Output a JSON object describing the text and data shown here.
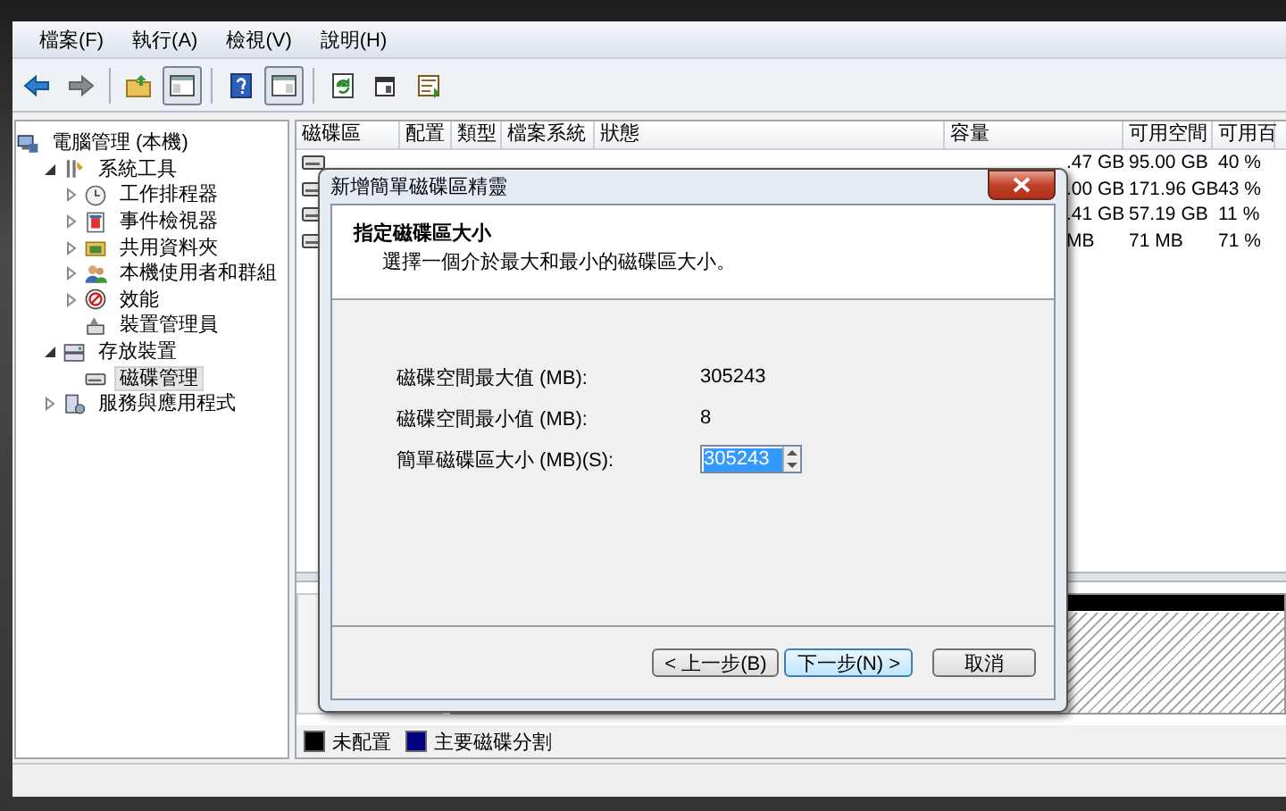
{
  "menu": [
    {
      "label": "檔案(F)"
    },
    {
      "label": "執行(A)"
    },
    {
      "label": "檢視(V)"
    },
    {
      "label": "說明(H)"
    }
  ],
  "toolbar": [
    {
      "kind": "back",
      "pressed": false
    },
    {
      "kind": "forward",
      "pressed": false
    },
    {
      "kind": "sep"
    },
    {
      "kind": "folder-up",
      "pressed": false
    },
    {
      "kind": "pane",
      "pressed": true
    },
    {
      "kind": "sep"
    },
    {
      "kind": "help",
      "pressed": false
    },
    {
      "kind": "pane2",
      "pressed": true
    },
    {
      "kind": "sep"
    },
    {
      "kind": "refresh",
      "pressed": false
    },
    {
      "kind": "properties",
      "pressed": false
    },
    {
      "kind": "export",
      "pressed": false
    }
  ],
  "tree": [
    {
      "label": "電腦管理 (本機)",
      "kind": "computer",
      "selected": false,
      "children": [
        {
          "label": "系統工具",
          "kind": "tools",
          "expanded": true,
          "selected": false,
          "children": [
            {
              "label": "工作排程器",
              "kind": "clock",
              "expanded": false,
              "selected": false
            },
            {
              "label": "事件檢視器",
              "kind": "event",
              "expanded": false,
              "selected": false
            },
            {
              "label": "共用資料夾",
              "kind": "share",
              "expanded": false,
              "selected": false
            },
            {
              "label": "本機使用者和群組",
              "kind": "users",
              "expanded": false,
              "selected": false
            },
            {
              "label": "效能",
              "kind": "perf",
              "expanded": false,
              "selected": false
            },
            {
              "label": "裝置管理員",
              "kind": "device",
              "selected": false
            }
          ]
        },
        {
          "label": "存放裝置",
          "kind": "storage",
          "expanded": true,
          "selected": false,
          "children": [
            {
              "label": "磁碟管理",
              "kind": "disk",
              "selected": true
            }
          ]
        },
        {
          "label": "服務與應用程式",
          "kind": "services",
          "expanded": false,
          "selected": false
        }
      ]
    }
  ],
  "volumes": {
    "columns": [
      "磁碟區",
      "配置",
      "類型",
      "檔案系統",
      "狀態",
      "容量",
      "可用空間",
      "可用百"
    ],
    "rows": [
      {
        "capacity": ".47 GB",
        "free": "95.00 GB",
        "free_pct": "40 %"
      },
      {
        "capacity": ".00 GB",
        "free": "171.96 GB",
        "free_pct": "43 %"
      },
      {
        "capacity": ".41 GB",
        "free": "57.19 GB",
        "free_pct": "11 %"
      },
      {
        "capacity": "MB",
        "free": "71 MB",
        "free_pct": "71 %"
      }
    ],
    "legend": [
      {
        "label": "未配置",
        "color": "#000000"
      },
      {
        "label": "主要磁碟分割",
        "color": "#000080"
      }
    ]
  },
  "dialog": {
    "title": "新增簡單磁碟區精靈",
    "heading": "指定磁碟區大小",
    "subtitle": "選擇一個介於最大和最小的磁碟區大小。",
    "fields": [
      {
        "kind": "text",
        "label": "磁碟空間最大值 (MB):",
        "value": "305243"
      },
      {
        "kind": "text",
        "label": "磁碟空間最小值 (MB):",
        "value": "8"
      },
      {
        "kind": "spinner",
        "label": "簡單磁碟區大小 (MB)(S):",
        "value": "305243",
        "text_selected": true
      }
    ],
    "buttons": [
      {
        "label": "< 上一步(B)",
        "focused": false
      },
      {
        "label": "下一步(N) >",
        "focused": true
      },
      {
        "label": "取消",
        "focused": false
      }
    ]
  }
}
